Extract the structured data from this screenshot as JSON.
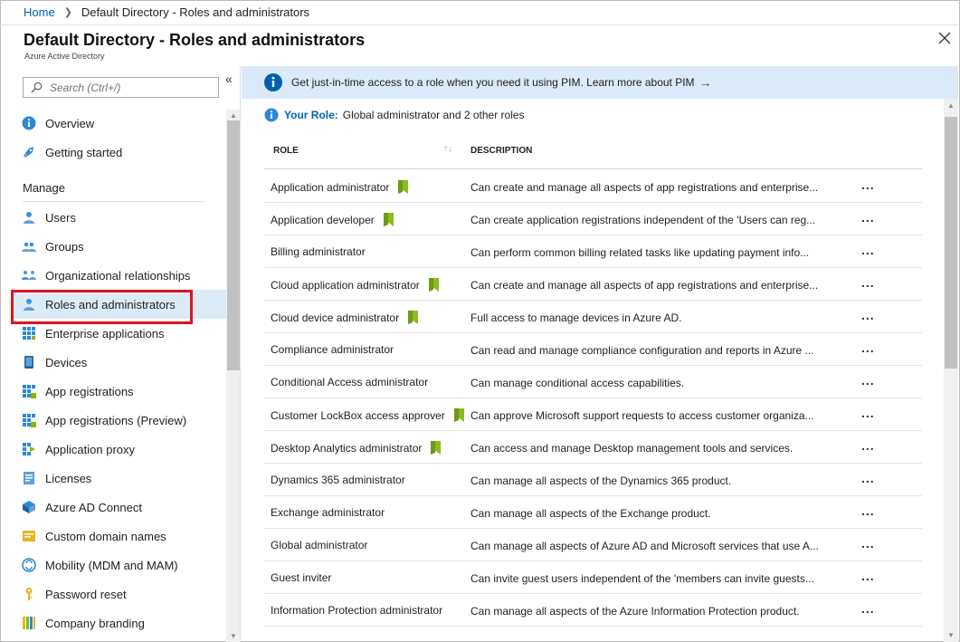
{
  "breadcrumb": {
    "home": "Home",
    "current": "Default Directory - Roles and administrators"
  },
  "header": {
    "title": "Default Directory - Roles and administrators",
    "subtitle": "Azure Active Directory"
  },
  "sidebar": {
    "search_placeholder": "Search (Ctrl+/)",
    "collapse": "«",
    "top_items": [
      {
        "label": "Overview",
        "icon": "info-icon"
      },
      {
        "label": "Getting started",
        "icon": "rocket-icon"
      }
    ],
    "section": "Manage",
    "items": [
      {
        "label": "Users",
        "icon": "user-icon"
      },
      {
        "label": "Groups",
        "icon": "group-icon"
      },
      {
        "label": "Organizational relationships",
        "icon": "org-relationships-icon"
      },
      {
        "label": "Roles and administrators",
        "icon": "role-admin-icon",
        "active": true
      },
      {
        "label": "Enterprise applications",
        "icon": "enterprise-apps-icon"
      },
      {
        "label": "Devices",
        "icon": "device-icon"
      },
      {
        "label": "App registrations",
        "icon": "app-registrations-icon"
      },
      {
        "label": "App registrations (Preview)",
        "icon": "app-registrations-preview-icon"
      },
      {
        "label": "Application proxy",
        "icon": "app-proxy-icon"
      },
      {
        "label": "Licenses",
        "icon": "license-icon"
      },
      {
        "label": "Azure AD Connect",
        "icon": "ad-connect-icon"
      },
      {
        "label": "Custom domain names",
        "icon": "domain-icon"
      },
      {
        "label": "Mobility (MDM and MAM)",
        "icon": "mobility-icon"
      },
      {
        "label": "Password reset",
        "icon": "key-icon"
      },
      {
        "label": "Company branding",
        "icon": "branding-icon"
      }
    ]
  },
  "banner": {
    "text": "Get just-in-time access to a role when you need it using PIM. Learn more about PIM",
    "arrow": "→"
  },
  "your_role": {
    "label": "Your Role:",
    "value": "Global administrator and 2 other roles"
  },
  "table": {
    "columns": [
      "ROLE",
      "DESCRIPTION"
    ],
    "sort_icon": "↑↓",
    "more": "...",
    "rows": [
      {
        "role": "Application administrator",
        "badge": true,
        "description": "Can create and manage all aspects of app registrations and enterprise..."
      },
      {
        "role": "Application developer",
        "badge": true,
        "description": "Can create application registrations independent of the 'Users can reg..."
      },
      {
        "role": "Billing administrator",
        "badge": false,
        "description": "Can perform common billing related tasks like updating payment info..."
      },
      {
        "role": "Cloud application administrator",
        "badge": true,
        "description": "Can create and manage all aspects of app registrations and enterprise..."
      },
      {
        "role": "Cloud device administrator",
        "badge": true,
        "description": "Full access to manage devices in Azure AD."
      },
      {
        "role": "Compliance administrator",
        "badge": false,
        "description": "Can read and manage compliance configuration and reports in Azure ..."
      },
      {
        "role": "Conditional Access administrator",
        "badge": false,
        "description": "Can manage conditional access capabilities."
      },
      {
        "role": "Customer LockBox access approver",
        "badge": true,
        "description": "Can approve Microsoft support requests to access customer organiza..."
      },
      {
        "role": "Desktop Analytics administrator",
        "badge": true,
        "description": "Can access and manage Desktop management tools and services."
      },
      {
        "role": "Dynamics 365 administrator",
        "badge": false,
        "description": "Can manage all aspects of the Dynamics 365 product."
      },
      {
        "role": "Exchange administrator",
        "badge": false,
        "description": "Can manage all aspects of the Exchange product."
      },
      {
        "role": "Global administrator",
        "badge": false,
        "description": "Can manage all aspects of Azure AD and Microsoft services that use A..."
      },
      {
        "role": "Guest inviter",
        "badge": false,
        "description": "Can invite guest users independent of the 'members can invite guests..."
      },
      {
        "role": "Information Protection administrator",
        "badge": false,
        "description": "Can manage all aspects of the Azure Information Protection product."
      }
    ]
  },
  "colors": {
    "accent": "#0062ad",
    "banner_bg": "#dbe9f9",
    "active_bg": "#dcebf8",
    "highlight_border": "#e0141e",
    "badge": "#8cba22"
  }
}
